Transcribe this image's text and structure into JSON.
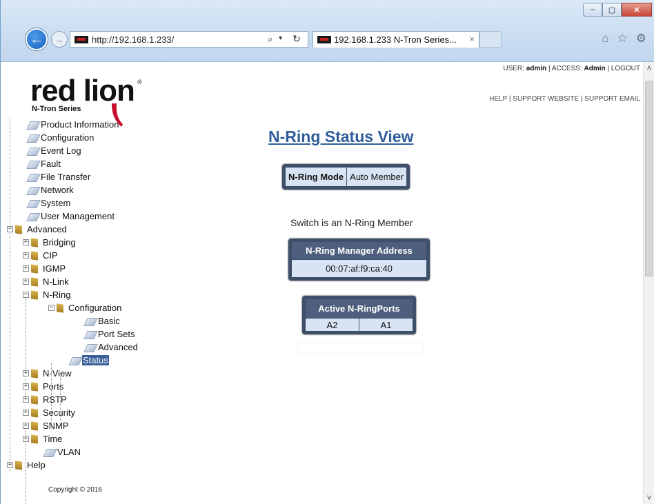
{
  "browser": {
    "url": "http://192.168.1.233/",
    "tab_title": "192.168.1.233 N-Tron Series...",
    "tab_close": "×",
    "min": "–",
    "max": "▢",
    "close": "✕"
  },
  "logo": {
    "word": "red lion",
    "sub": "N-Tron Series",
    "reg": "®"
  },
  "header": {
    "user_label": "USER:",
    "user": "admin",
    "access_label": "ACCESS:",
    "access": "Admin",
    "logout": "LOGOUT",
    "help": "HELP",
    "support_website": "SUPPORT WEBSITE",
    "support_email": "SUPPORT EMAIL",
    "sep": "|"
  },
  "tree": {
    "product_information": "Product Information",
    "configuration": "Configuration",
    "event_log": "Event Log",
    "fault": "Fault",
    "file_transfer": "File Transfer",
    "network": "Network",
    "system": "System",
    "user_management": "User Management",
    "advanced": "Advanced",
    "bridging": "Bridging",
    "cip": "CIP",
    "igmp": "IGMP",
    "nlink": "N-Link",
    "nring": "N-Ring",
    "nring_configuration": "Configuration",
    "basic": "Basic",
    "port_sets": "Port Sets",
    "advanced_sub": "Advanced",
    "status": "Status",
    "nview": "N-View",
    "ports": "Ports",
    "rstp": "RSTP",
    "security": "Security",
    "snmp": "SNMP",
    "time": "Time",
    "vlan": "VLAN",
    "help": "Help"
  },
  "copyright": "Copyright © 2016",
  "main": {
    "title": "N-Ring Status View",
    "mode_label": "N-Ring Mode",
    "mode_value": "Auto Member",
    "switch_message": "Switch is an N-Ring Member",
    "manager_header": "N-Ring Manager Address",
    "manager_value": "00:07:af:f9:ca:40",
    "ports_header": "Active N-RingPorts",
    "ports": [
      "A2",
      "A1"
    ]
  }
}
